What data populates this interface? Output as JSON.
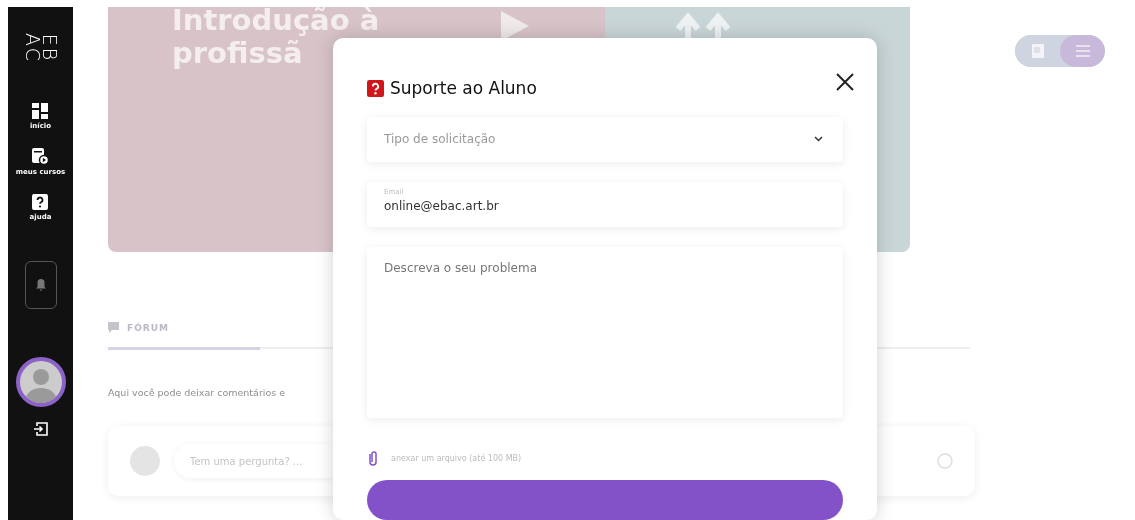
{
  "sidebar": {
    "logo": [
      "EB",
      "AC"
    ],
    "items": [
      {
        "kind": "home",
        "label": "início"
      },
      {
        "kind": "courses",
        "label": "meus cursos"
      },
      {
        "kind": "help",
        "label": "ajuda"
      }
    ]
  },
  "course_banner": {
    "title_lines": [
      "Introdução à",
      "profissã"
    ]
  },
  "view_toggle": [
    {
      "kind": "grid",
      "selected": false
    },
    {
      "kind": "list",
      "selected": true
    }
  ],
  "forum": {
    "tab": "FÓRUM",
    "description": "Aqui você pode deixar comentários e",
    "question_placeholder": "Tem uma pergunta? ..."
  },
  "modal": {
    "title": "Suporte ao Aluno",
    "request_type_placeholder": "Tipo de solicitação",
    "email_label": "Email",
    "email_value": "online@ebac.art.br",
    "description_placeholder": "Descreva o seu problema",
    "attach_text": "anexar um arquivo (até 100 MB)"
  }
}
